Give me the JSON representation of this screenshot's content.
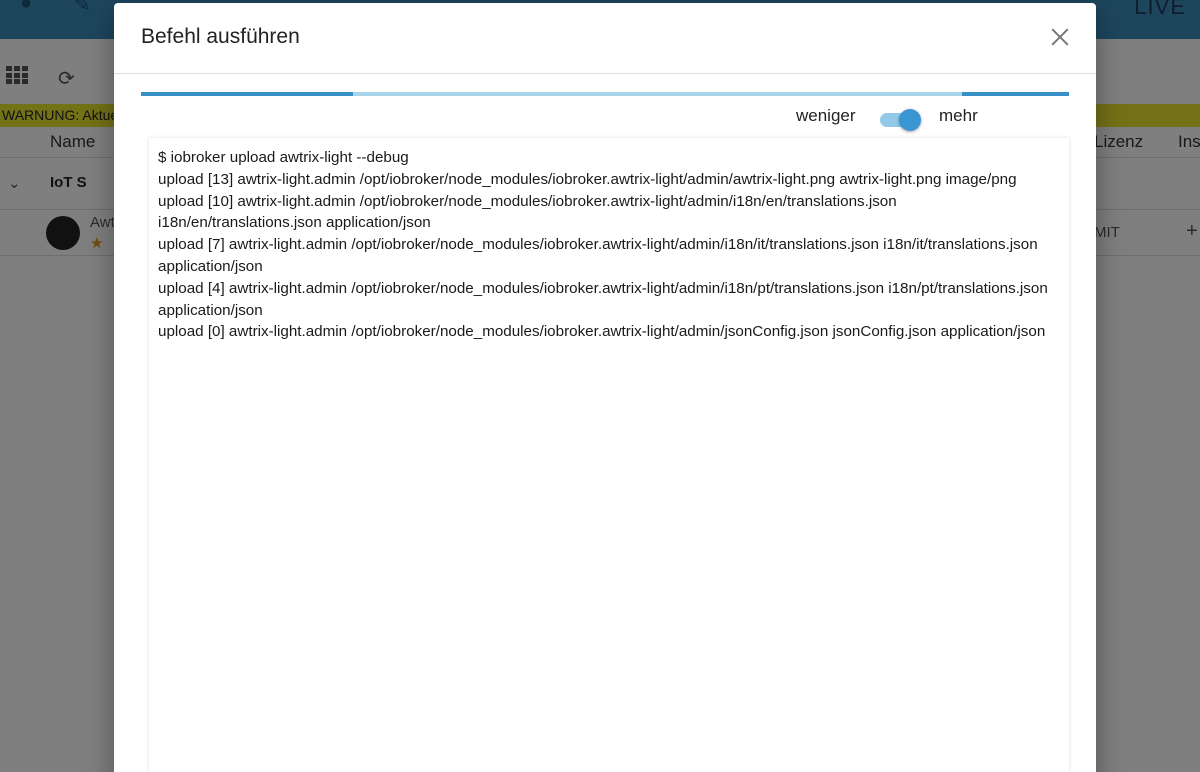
{
  "background": {
    "live_label": "LIVE",
    "warning_text": "WARNUNG: Aktue",
    "columns": {
      "name": "Name",
      "license": "Lizenz",
      "install": "Ins"
    },
    "group_row": {
      "label": "IoT S"
    },
    "adapter_row": {
      "name": "Awt",
      "license": "MIT"
    }
  },
  "dialog": {
    "title": "Befehl ausführen",
    "toggle": {
      "less_label": "weniger",
      "more_label": "mehr",
      "state": "mehr"
    },
    "progress": {
      "segments_done": [
        0.23,
        0.115
      ]
    },
    "console_lines": [
      "$ iobroker upload awtrix-light --debug",
      "upload [13] awtrix-light.admin /opt/iobroker/node_modules/iobroker.awtrix-light/admin/awtrix-light.png awtrix-light.png image/png",
      "upload [10] awtrix-light.admin /opt/iobroker/node_modules/iobroker.awtrix-light/admin/i18n/en/translations.json i18n/en/translations.json application/json",
      "upload [7] awtrix-light.admin /opt/iobroker/node_modules/iobroker.awtrix-light/admin/i18n/it/translations.json i18n/it/translations.json application/json",
      "upload [4] awtrix-light.admin /opt/iobroker/node_modules/iobroker.awtrix-light/admin/i18n/pt/translations.json i18n/pt/translations.json application/json",
      "upload [0] awtrix-light.admin /opt/iobroker/node_modules/iobroker.awtrix-light/admin/jsonConfig.json jsonConfig.json application/json"
    ]
  }
}
